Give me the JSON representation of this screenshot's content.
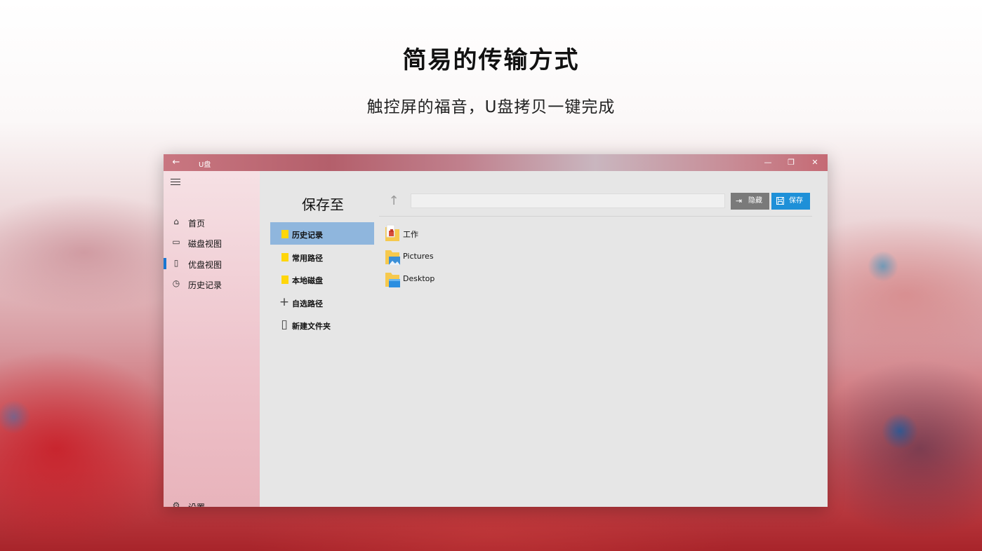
{
  "promo": {
    "title": "简易的传输方式",
    "subtitle": "触控屏的福音，U盘拷贝一键完成"
  },
  "window": {
    "title": "U盘",
    "back_icon": "←",
    "min_icon": "—",
    "max_icon": "❐",
    "close_icon": "✕"
  },
  "sidebar": {
    "items": [
      {
        "label": "首页",
        "icon": "⌂"
      },
      {
        "label": "磁盘视图",
        "icon": "▭"
      },
      {
        "label": "优盘视图",
        "icon": "▯"
      },
      {
        "label": "历史记录",
        "icon": "◷"
      }
    ],
    "settings": {
      "label": "设置",
      "icon": "⚙"
    },
    "accent_color": "#1976d2"
  },
  "save_panel": {
    "title": "保存至",
    "items": [
      {
        "label": "历史记录",
        "selected": true
      },
      {
        "label": "常用路径",
        "selected": false
      },
      {
        "label": "本地磁盘",
        "selected": false
      },
      {
        "label": "自选路径",
        "glyph": "+"
      },
      {
        "label": "新建文件夹",
        "glyph": "▯"
      }
    ],
    "selected_color": "#8fb6dd",
    "folder_color": "#ffd60a"
  },
  "toolbar": {
    "up_icon": "↑",
    "path_value": "",
    "hide_label": "隐藏",
    "hide_icon": "⇥",
    "save_label": "保存",
    "save_icon": "💾"
  },
  "files": [
    {
      "name": "工作"
    },
    {
      "name": "Pictures"
    },
    {
      "name": "Desktop"
    }
  ]
}
